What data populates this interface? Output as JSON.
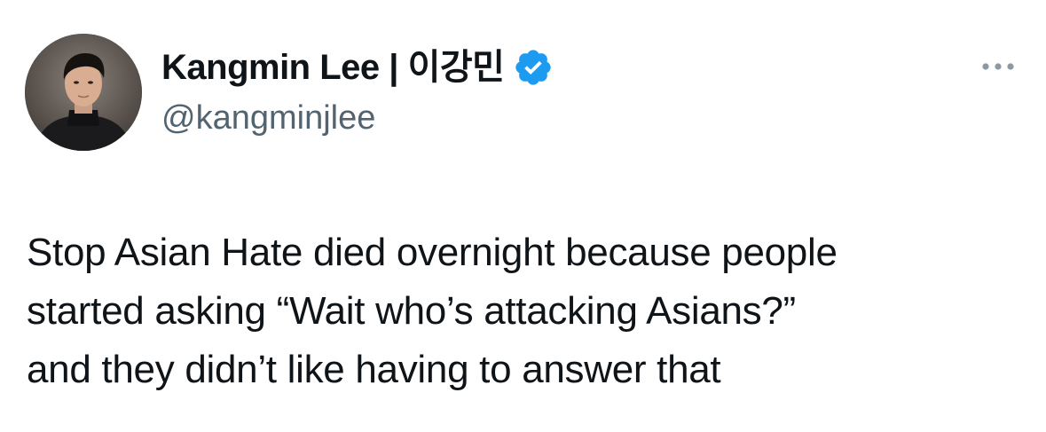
{
  "author": {
    "display_name": "Kangmin Lee | 이강민",
    "handle": "@kangminjlee",
    "verified": true,
    "verified_color": "#1d9bf0",
    "avatar_icon": "profile-photo-avatar"
  },
  "actions": {
    "more_icon": "more-horizontal-icon"
  },
  "tweet": {
    "lines": [
      "Stop Asian Hate died overnight because people",
      "started asking “Wait who’s attacking Asians?”",
      "and they didn’t like having to answer that"
    ]
  },
  "colors": {
    "text_primary": "#0f1419",
    "text_secondary": "#536471",
    "accent": "#1d9bf0"
  }
}
